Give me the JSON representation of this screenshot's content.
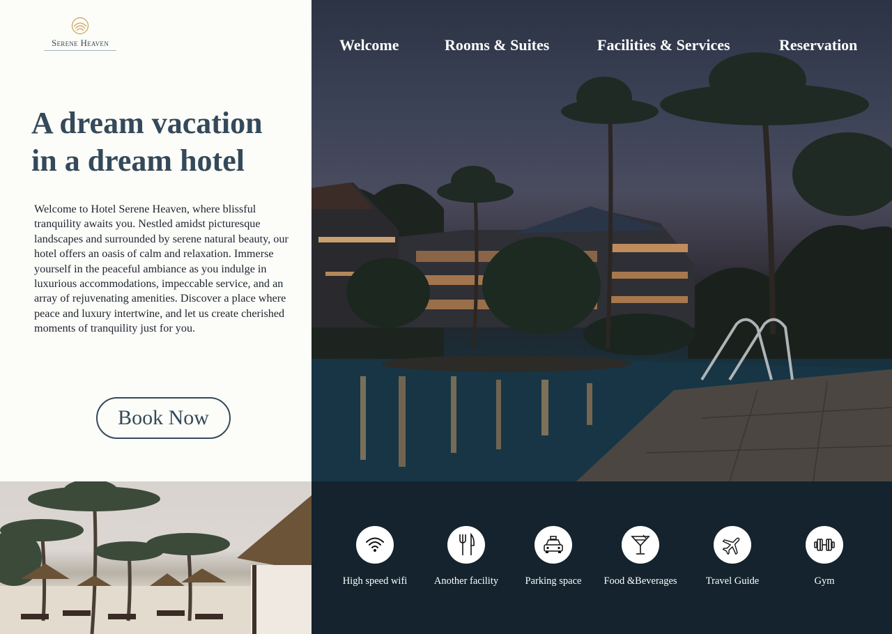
{
  "brand": {
    "name": "Serene Heaven",
    "logo_icon": "sunrise-logo-icon",
    "accent": "#c9a157"
  },
  "nav": {
    "items": [
      {
        "label": "Welcome"
      },
      {
        "label": "Rooms & Suites"
      },
      {
        "label": "Facilities & Services"
      },
      {
        "label": "Reservation"
      }
    ]
  },
  "hero": {
    "title_line1": "A dream vacation",
    "title_line2": "in a dream hotel",
    "intro": "Welcome to Hotel Serene Heaven, where blissful tranquility awaits you. Nestled amidst picturesque landscapes and surrounded by serene natural beauty, our hotel offers an oasis of calm and relaxation. Immerse yourself in the peaceful ambiance as you indulge in luxurious accommodations, impeccable service, and an array of rejuvenating amenities. Discover a place where peace and luxury intertwine, and let us create cherished moments of tranquility just for you.",
    "cta_label": "Book Now"
  },
  "facilities": [
    {
      "label": "High speed wifi",
      "icon": "wifi-icon"
    },
    {
      "label": "Another facility",
      "icon": "fork-knife-icon"
    },
    {
      "label": "Parking space",
      "icon": "taxi-icon"
    },
    {
      "label": "Food &Beverages",
      "icon": "cocktail-icon"
    },
    {
      "label": "Travel Guide",
      "icon": "airplane-icon"
    },
    {
      "label": "Gym",
      "icon": "dumbbell-icon"
    }
  ],
  "colors": {
    "heading": "#34495a",
    "panel_bg": "#fcfcf8",
    "facilities_bg": "#14232d"
  }
}
